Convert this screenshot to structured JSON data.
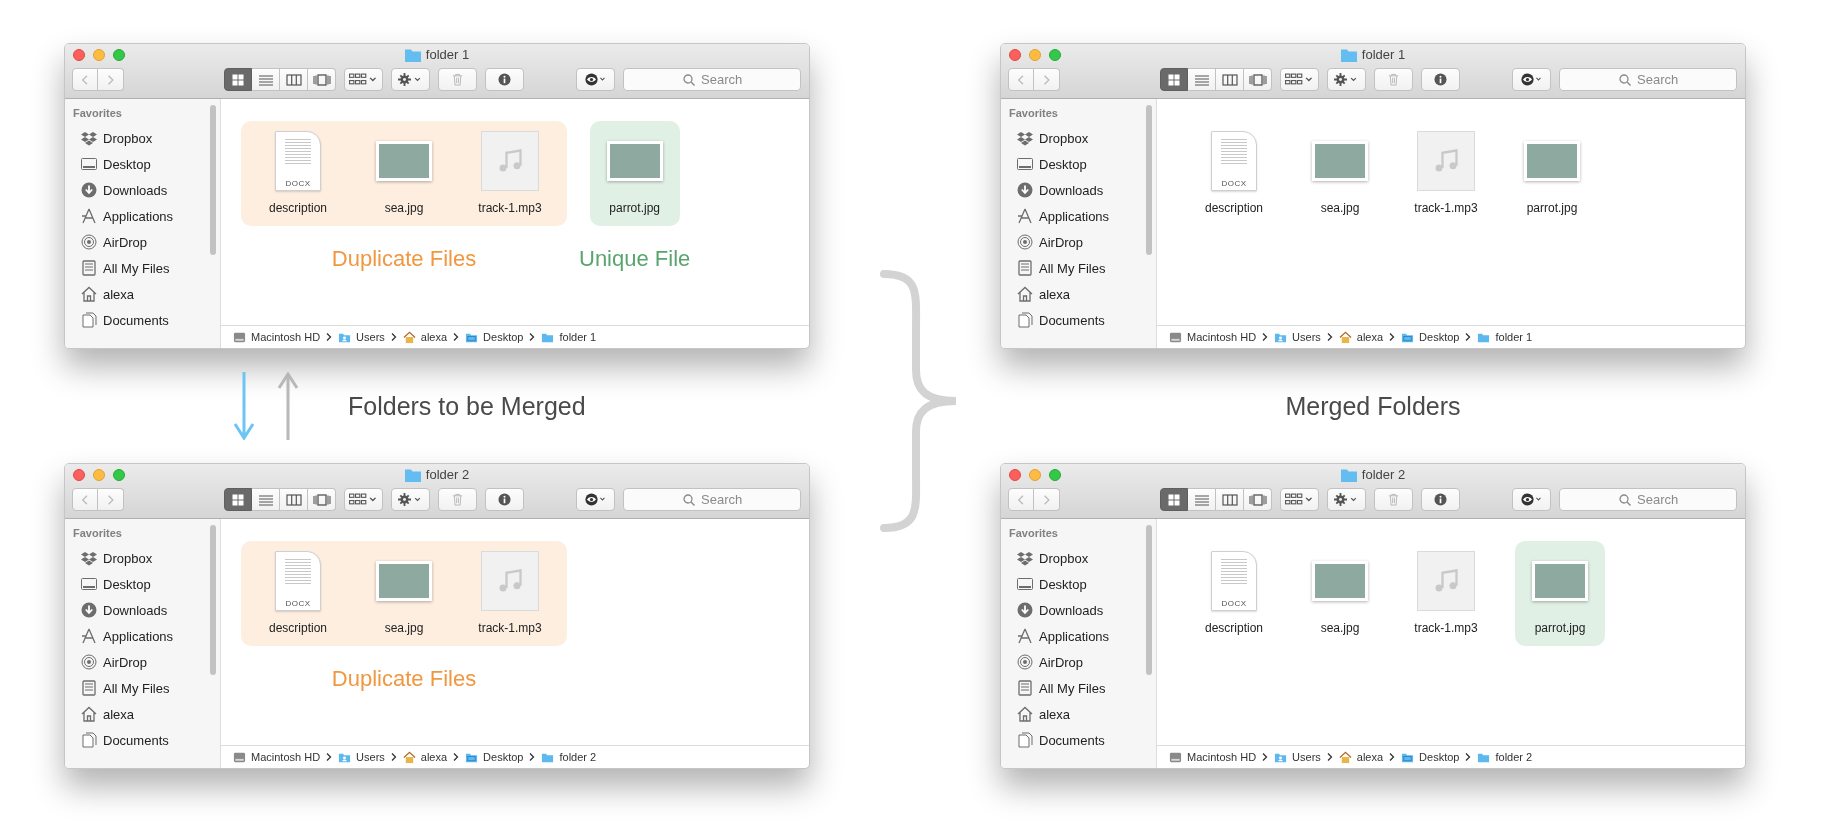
{
  "windows": [
    {
      "title": "folder 1",
      "search": {
        "placeholder": "Search"
      },
      "view_modes": [
        {
          "kind": "icon",
          "selected": true
        },
        {
          "kind": "list",
          "selected": false
        },
        {
          "kind": "column",
          "selected": false
        },
        {
          "kind": "coverflow",
          "selected": false
        }
      ],
      "sidebar": {
        "heading": "Favorites",
        "items": [
          {
            "label": "Dropbox",
            "kind": "dropbox"
          },
          {
            "label": "Desktop",
            "kind": "desktop"
          },
          {
            "label": "Downloads",
            "kind": "downloads"
          },
          {
            "label": "Applications",
            "kind": "applications"
          },
          {
            "label": "AirDrop",
            "kind": "airdrop"
          },
          {
            "label": "All My Files",
            "kind": "allfiles"
          },
          {
            "label": "alexa",
            "kind": "home"
          },
          {
            "label": "Documents",
            "kind": "documents"
          }
        ]
      },
      "file_groups": [
        {
          "kind": "duplicate",
          "label": "Duplicate Files",
          "files": [
            {
              "name": "description",
              "kind": "docx",
              "badge": "DOCX"
            },
            {
              "name": "sea.jpg",
              "kind": "image"
            },
            {
              "name": "track-1.mp3",
              "kind": "audio"
            }
          ]
        },
        {
          "kind": "unique",
          "label": "Unique File",
          "files": [
            {
              "name": "parrot.jpg",
              "kind": "image"
            }
          ]
        }
      ],
      "path": [
        {
          "label": "Macintosh HD",
          "kind": "disk"
        },
        {
          "label": "Users",
          "kind": "users"
        },
        {
          "label": "alexa",
          "kind": "home"
        },
        {
          "label": "Desktop",
          "kind": "desktop"
        },
        {
          "label": "folder 1",
          "kind": "folder"
        }
      ]
    },
    {
      "title": "folder 1",
      "search": {
        "placeholder": "Search"
      },
      "view_modes": [
        {
          "kind": "icon",
          "selected": true
        },
        {
          "kind": "list",
          "selected": false
        },
        {
          "kind": "column",
          "selected": false
        },
        {
          "kind": "coverflow",
          "selected": false
        }
      ],
      "sidebar": {
        "heading": "Favorites",
        "items": [
          {
            "label": "Dropbox",
            "kind": "dropbox"
          },
          {
            "label": "Desktop",
            "kind": "desktop"
          },
          {
            "label": "Downloads",
            "kind": "downloads"
          },
          {
            "label": "Applications",
            "kind": "applications"
          },
          {
            "label": "AirDrop",
            "kind": "airdrop"
          },
          {
            "label": "All My Files",
            "kind": "allfiles"
          },
          {
            "label": "alexa",
            "kind": "home"
          },
          {
            "label": "Documents",
            "kind": "documents"
          }
        ]
      },
      "file_groups": [
        {
          "kind": "plain",
          "files": [
            {
              "name": "description",
              "kind": "docx",
              "badge": "DOCX"
            },
            {
              "name": "sea.jpg",
              "kind": "image"
            },
            {
              "name": "track-1.mp3",
              "kind": "audio"
            },
            {
              "name": "parrot.jpg",
              "kind": "image"
            }
          ]
        }
      ],
      "path": [
        {
          "label": "Macintosh HD",
          "kind": "disk"
        },
        {
          "label": "Users",
          "kind": "users"
        },
        {
          "label": "alexa",
          "kind": "home"
        },
        {
          "label": "Desktop",
          "kind": "desktop"
        },
        {
          "label": "folder 1",
          "kind": "folder"
        }
      ]
    },
    {
      "title": "folder 2",
      "search": {
        "placeholder": "Search"
      },
      "view_modes": [
        {
          "kind": "icon",
          "selected": true
        },
        {
          "kind": "list",
          "selected": false
        },
        {
          "kind": "column",
          "selected": false
        },
        {
          "kind": "coverflow",
          "selected": false
        }
      ],
      "sidebar": {
        "heading": "Favorites",
        "items": [
          {
            "label": "Dropbox",
            "kind": "dropbox"
          },
          {
            "label": "Desktop",
            "kind": "desktop"
          },
          {
            "label": "Downloads",
            "kind": "downloads"
          },
          {
            "label": "Applications",
            "kind": "applications"
          },
          {
            "label": "AirDrop",
            "kind": "airdrop"
          },
          {
            "label": "All My Files",
            "kind": "allfiles"
          },
          {
            "label": "alexa",
            "kind": "home"
          },
          {
            "label": "Documents",
            "kind": "documents"
          }
        ]
      },
      "file_groups": [
        {
          "kind": "duplicate",
          "label": "Duplicate Files",
          "files": [
            {
              "name": "description",
              "kind": "docx",
              "badge": "DOCX"
            },
            {
              "name": "sea.jpg",
              "kind": "image"
            },
            {
              "name": "track-1.mp3",
              "kind": "audio"
            }
          ]
        }
      ],
      "path": [
        {
          "label": "Macintosh HD",
          "kind": "disk"
        },
        {
          "label": "Users",
          "kind": "users"
        },
        {
          "label": "alexa",
          "kind": "home"
        },
        {
          "label": "Desktop",
          "kind": "desktop"
        },
        {
          "label": "folder 2",
          "kind": "folder"
        }
      ]
    },
    {
      "title": "folder 2",
      "search": {
        "placeholder": "Search"
      },
      "view_modes": [
        {
          "kind": "icon",
          "selected": true
        },
        {
          "kind": "list",
          "selected": false
        },
        {
          "kind": "column",
          "selected": false
        },
        {
          "kind": "coverflow",
          "selected": false
        }
      ],
      "sidebar": {
        "heading": "Favorites",
        "items": [
          {
            "label": "Dropbox",
            "kind": "dropbox"
          },
          {
            "label": "Desktop",
            "kind": "desktop"
          },
          {
            "label": "Downloads",
            "kind": "downloads"
          },
          {
            "label": "Applications",
            "kind": "applications"
          },
          {
            "label": "AirDrop",
            "kind": "airdrop"
          },
          {
            "label": "All My Files",
            "kind": "allfiles"
          },
          {
            "label": "alexa",
            "kind": "home"
          },
          {
            "label": "Documents",
            "kind": "documents"
          }
        ]
      },
      "file_groups": [
        {
          "kind": "plain",
          "files": [
            {
              "name": "description",
              "kind": "docx",
              "badge": "DOCX"
            },
            {
              "name": "sea.jpg",
              "kind": "image"
            },
            {
              "name": "track-1.mp3",
              "kind": "audio"
            }
          ]
        },
        {
          "kind": "unique",
          "files": [
            {
              "name": "parrot.jpg",
              "kind": "image"
            }
          ]
        }
      ],
      "path": [
        {
          "label": "Macintosh HD",
          "kind": "disk"
        },
        {
          "label": "Users",
          "kind": "users"
        },
        {
          "label": "alexa",
          "kind": "home"
        },
        {
          "label": "Desktop",
          "kind": "desktop"
        },
        {
          "label": "folder 2",
          "kind": "folder"
        }
      ]
    }
  ],
  "captions": {
    "left": "Folders to be Merged",
    "right": "Merged Folders"
  }
}
